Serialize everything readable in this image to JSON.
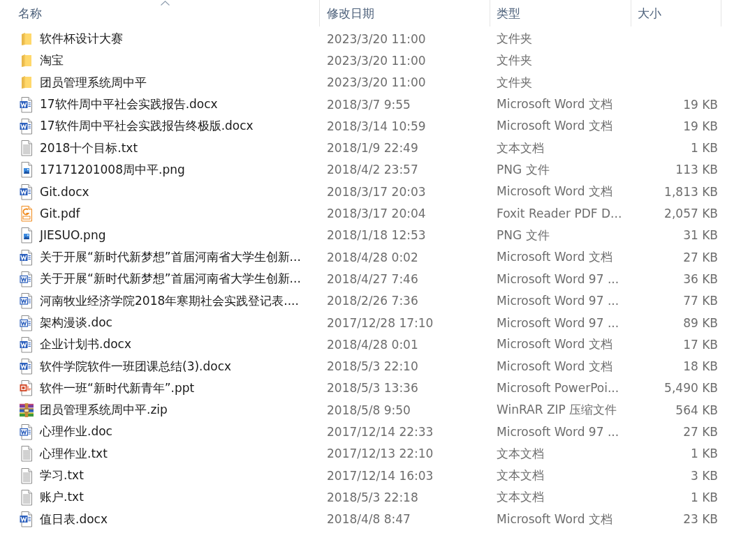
{
  "columns": [
    {
      "label": "名称",
      "sorted": true
    },
    {
      "label": "修改日期",
      "sorted": false
    },
    {
      "label": "类型",
      "sorted": false
    },
    {
      "label": "大小",
      "sorted": false
    }
  ],
  "files": [
    {
      "kind": "folder",
      "name": "软件杯设计大赛",
      "modified": "2023/3/20 11:00",
      "type": "文件夹"
    },
    {
      "kind": "folder",
      "name": "淘宝",
      "modified": "2023/3/20 11:00",
      "type": "文件夹"
    },
    {
      "kind": "folder",
      "name": "团员管理系统周中平",
      "modified": "2023/3/20 11:00",
      "type": "文件夹"
    },
    {
      "kind": "docx",
      "name": "17软件周中平社会实践报告.docx",
      "modified": "2018/3/7 9:55",
      "type": "Microsoft Word 文档",
      "size": "19 KB"
    },
    {
      "kind": "docx",
      "name": "17软件周中平社会实践报告终极版.docx",
      "modified": "2018/3/14 10:59",
      "type": "Microsoft Word 文档",
      "size": "19 KB"
    },
    {
      "kind": "txt",
      "name": "2018十个目标.txt",
      "modified": "2018/1/9 22:49",
      "type": "文本文档",
      "size": "1 KB"
    },
    {
      "kind": "png",
      "name": "17171201008周中平.png",
      "modified": "2018/4/2 23:57",
      "type": "PNG 文件",
      "size": "113 KB"
    },
    {
      "kind": "docx",
      "name": "Git.docx",
      "modified": "2018/3/17 20:03",
      "type": "Microsoft Word 文档",
      "size": "1,813 KB"
    },
    {
      "kind": "pdf",
      "name": "Git.pdf",
      "modified": "2018/3/17 20:04",
      "type": "Foxit Reader PDF D...",
      "size": "2,057 KB"
    },
    {
      "kind": "png",
      "name": "JIESUO.png",
      "modified": "2018/1/18 12:53",
      "type": "PNG 文件",
      "size": "31 KB"
    },
    {
      "kind": "docx",
      "name": "关于开展“新时代新梦想”首届河南省大学生创新...",
      "modified": "2018/4/28 0:02",
      "type": "Microsoft Word 文档",
      "size": "27 KB"
    },
    {
      "kind": "doc",
      "name": "关于开展“新时代新梦想”首届河南省大学生创新...",
      "modified": "2018/4/27 7:46",
      "type": "Microsoft Word 97 ...",
      "size": "36 KB"
    },
    {
      "kind": "doc",
      "name": "河南牧业经济学院2018年寒期社会实践登记表....",
      "modified": "2018/2/26 7:36",
      "type": "Microsoft Word 97 ...",
      "size": "77 KB"
    },
    {
      "kind": "doc",
      "name": "架构漫谈.doc",
      "modified": "2017/12/28 17:10",
      "type": "Microsoft Word 97 ...",
      "size": "89 KB"
    },
    {
      "kind": "docx",
      "name": "企业计划书.docx",
      "modified": "2018/4/28 0:01",
      "type": "Microsoft Word 文档",
      "size": "17 KB"
    },
    {
      "kind": "docx",
      "name": "软件学院软件一班团课总结(3).docx",
      "modified": "2018/5/3 22:10",
      "type": "Microsoft Word 文档",
      "size": "18 KB"
    },
    {
      "kind": "ppt",
      "name": "软件一班“新时代新青年”.ppt",
      "modified": "2018/5/3 13:36",
      "type": "Microsoft PowerPoi...",
      "size": "5,490 KB"
    },
    {
      "kind": "zip",
      "name": "团员管理系统周中平.zip",
      "modified": "2018/5/8 9:50",
      "type": "WinRAR ZIP 压缩文件",
      "size": "564 KB"
    },
    {
      "kind": "doc",
      "name": "心理作业.doc",
      "modified": "2017/12/14 22:33",
      "type": "Microsoft Word 97 ...",
      "size": "27 KB"
    },
    {
      "kind": "txt",
      "name": "心理作业.txt",
      "modified": "2017/12/13 22:10",
      "type": "文本文档",
      "size": "1 KB"
    },
    {
      "kind": "txt",
      "name": "学习.txt",
      "modified": "2017/12/14 16:03",
      "type": "文本文档",
      "size": "3 KB"
    },
    {
      "kind": "txt",
      "name": "账户.txt",
      "modified": "2018/5/3 22:18",
      "type": "文本文档",
      "size": "1 KB"
    },
    {
      "kind": "docx",
      "name": "值日表.docx",
      "modified": "2018/4/8 8:47",
      "type": "Microsoft Word 文档",
      "size": "23 KB"
    }
  ]
}
